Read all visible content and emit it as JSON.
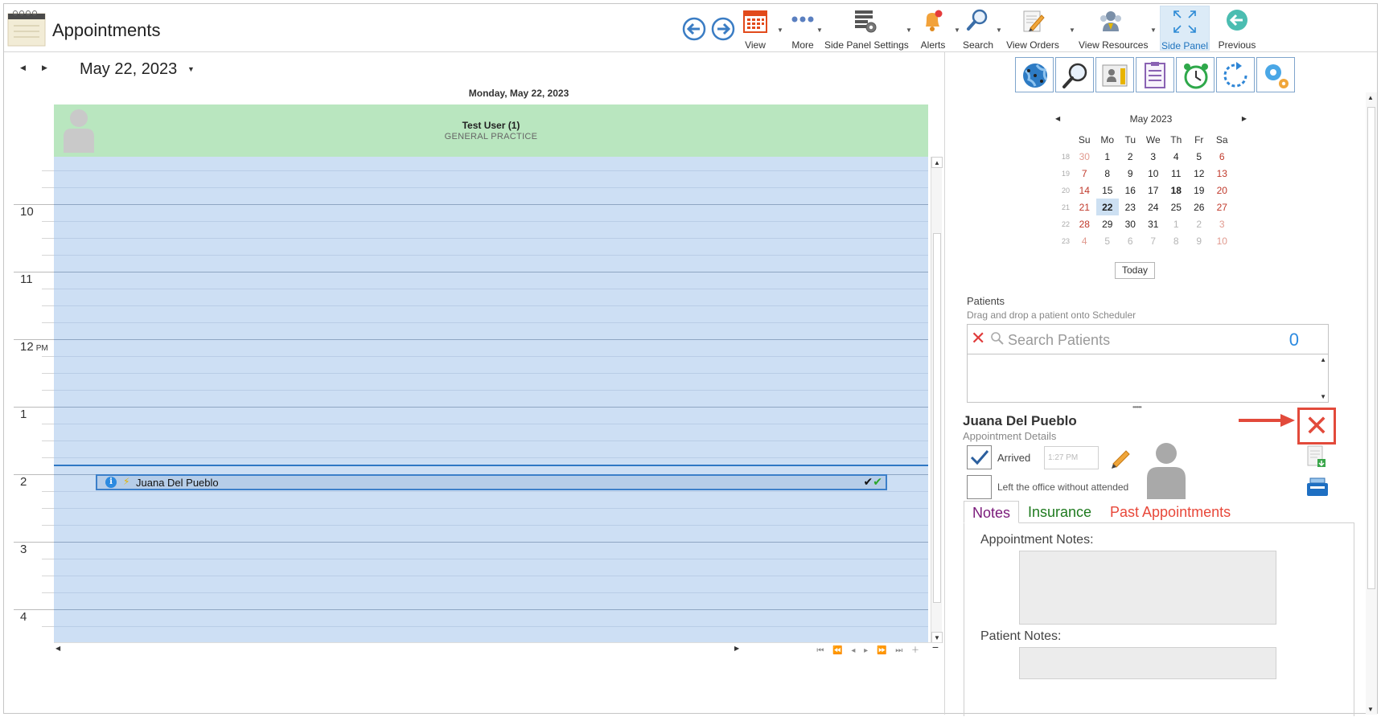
{
  "app": {
    "title": "Appointments"
  },
  "toolbar": {
    "back_label": "",
    "forward_label": "",
    "view": "View",
    "more": "More",
    "side_panel_settings": "Side Panel Settings",
    "alerts": "Alerts",
    "search": "Search",
    "view_orders": "View Orders",
    "view_resources": "View Resources",
    "side_panel": "Side Panel",
    "previous": "Previous"
  },
  "scheduler": {
    "date_label": "May 22, 2023",
    "day_header": "Monday, May 22, 2023",
    "resource_name": "Test User (1)",
    "resource_dept": "GENERAL PRACTICE",
    "hours": [
      {
        "h": "10",
        "suffix": ""
      },
      {
        "h": "11",
        "suffix": ""
      },
      {
        "h": "12",
        "suffix": "PM"
      },
      {
        "h": "1",
        "suffix": ""
      },
      {
        "h": "2",
        "suffix": ""
      },
      {
        "h": "3",
        "suffix": ""
      },
      {
        "h": "4",
        "suffix": ""
      }
    ],
    "appointment": {
      "name": "Juana Del Pueblo",
      "info_glyph": "i"
    }
  },
  "side_panel": {
    "tools": [
      "globe-icon",
      "search-icon",
      "contact-card-icon",
      "checklist-icon",
      "alarm-clock-icon",
      "refresh-icon",
      "settings-gears-icon"
    ],
    "calendar": {
      "month": "May 2023",
      "days_of_week": [
        "Su",
        "Mo",
        "Tu",
        "We",
        "Th",
        "Fr",
        "Sa"
      ],
      "weeks": [
        {
          "wk": "18",
          "days": [
            "30",
            "1",
            "2",
            "3",
            "4",
            "5",
            "6"
          ]
        },
        {
          "wk": "19",
          "days": [
            "7",
            "8",
            "9",
            "10",
            "11",
            "12",
            "13"
          ]
        },
        {
          "wk": "20",
          "days": [
            "14",
            "15",
            "16",
            "17",
            "18",
            "19",
            "20"
          ]
        },
        {
          "wk": "21",
          "days": [
            "21",
            "22",
            "23",
            "24",
            "25",
            "26",
            "27"
          ]
        },
        {
          "wk": "22",
          "days": [
            "28",
            "29",
            "30",
            "31",
            "1",
            "2",
            "3"
          ]
        },
        {
          "wk": "23",
          "days": [
            "4",
            "5",
            "6",
            "7",
            "8",
            "9",
            "10"
          ]
        }
      ],
      "selected_day": "22",
      "today_label": "Today"
    },
    "patients": {
      "label": "Patients",
      "hint": "Drag and drop a patient onto Scheduler",
      "search_placeholder": "Search Patients",
      "count": "0"
    },
    "detail": {
      "name": "Juana Del Pueblo",
      "subtitle": "Appointment Details",
      "arrived_label": "Arrived",
      "arrived_checked": true,
      "arrived_time": "1:27 PM",
      "left_label": "Left the office without attended",
      "tabs": [
        "Notes",
        "Insurance",
        "Past Appointments"
      ],
      "appointment_notes_label": "Appointment Notes:",
      "patient_notes_label": "Patient Notes:"
    }
  },
  "colors": {
    "accent": "#1e73be",
    "resource_header": "#b9e6bf",
    "slot_bg": "#cddff4",
    "close_red": "#e24a3b"
  }
}
